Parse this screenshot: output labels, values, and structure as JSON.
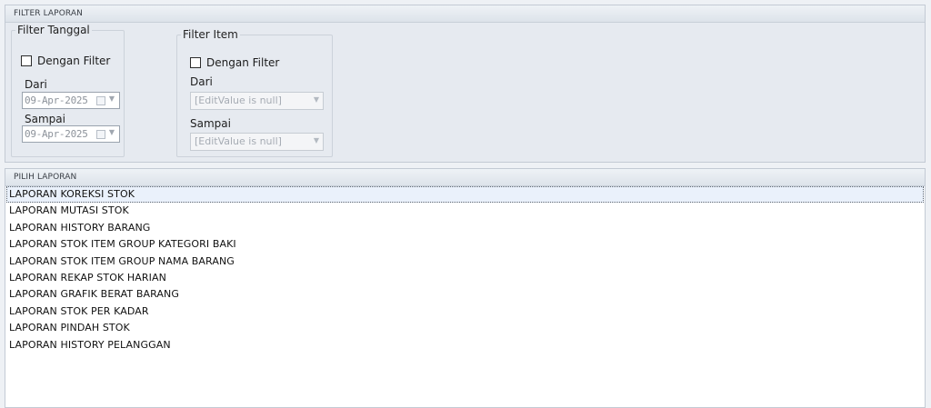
{
  "filter_panel": {
    "title": "FILTER LAPORAN",
    "tanggal": {
      "legend": "Filter Tanggal",
      "checkbox_label": "Dengan Filter",
      "checked": false,
      "dari_label": "Dari",
      "dari_value": "09-Apr-2025",
      "sampai_label": "Sampai",
      "sampai_value": "09-Apr-2025"
    },
    "item": {
      "legend": "Filter Item",
      "checkbox_label": "Dengan Filter",
      "checked": false,
      "dari_label": "Dari",
      "dari_value": "[EditValue is null]",
      "sampai_label": "Sampai",
      "sampai_value": "[EditValue is null]"
    }
  },
  "report_panel": {
    "title": "PILIH LAPORAN",
    "selected_index": 0,
    "items": [
      "LAPORAN KOREKSI STOK",
      "LAPORAN MUTASI STOK",
      "LAPORAN HISTORY BARANG",
      "LAPORAN STOK ITEM GROUP KATEGORI BAKI",
      "LAPORAN STOK ITEM GROUP NAMA BARANG",
      "LAPORAN REKAP STOK HARIAN",
      "LAPORAN GRAFIK BERAT BARANG",
      "LAPORAN STOK PER KADAR",
      "LAPORAN PINDAH STOK",
      "LAPORAN HISTORY PELANGGAN"
    ]
  }
}
